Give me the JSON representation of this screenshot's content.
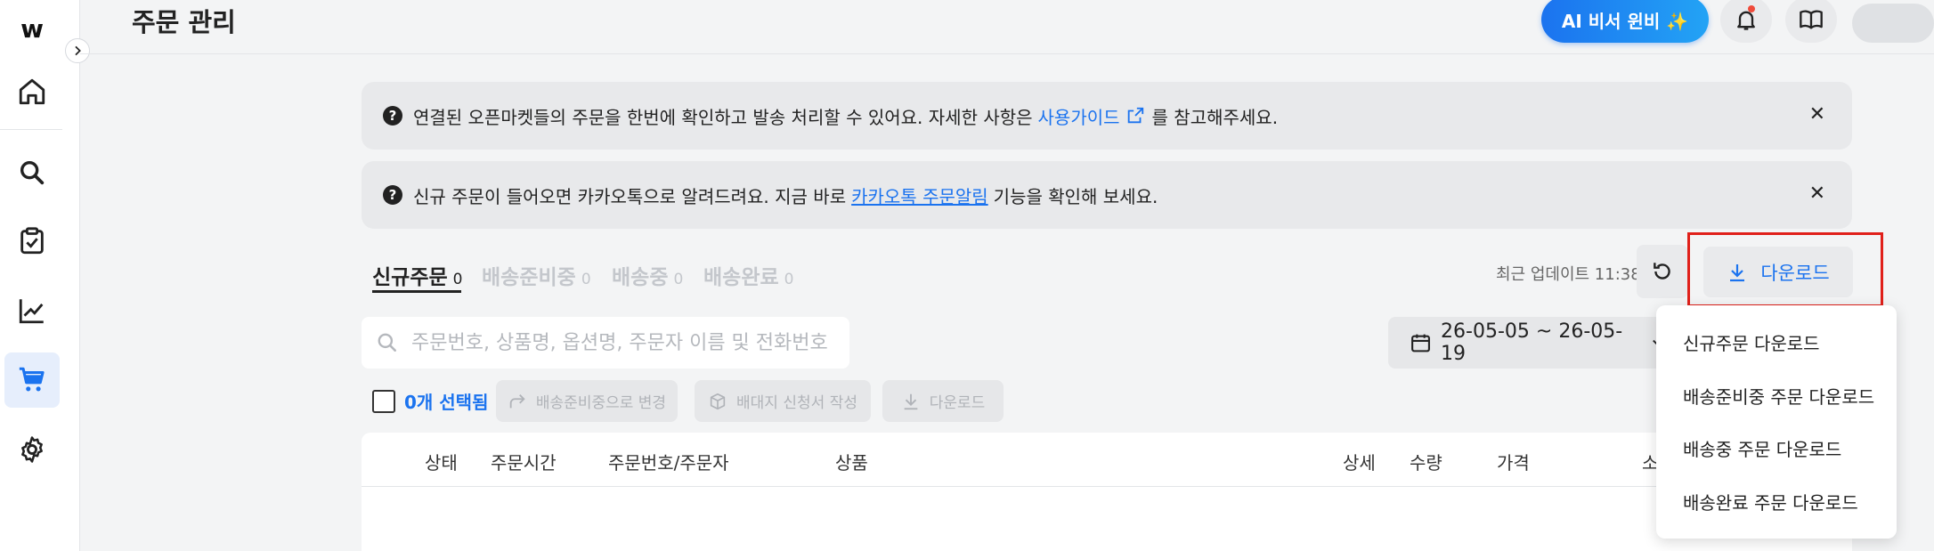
{
  "app": {
    "logo": "w"
  },
  "header": {
    "title": "주문 관리",
    "ai_button": "AI 비서 윈비 ✨"
  },
  "banners": [
    {
      "prefix": "연결된 오픈마켓들의 주문을 한번에 확인하고 발송 처리할 수 있어요. 자세한 사항은",
      "link": "사용가이드",
      "suffix": "를 참고해주세요."
    },
    {
      "prefix": "신규 주문이 들어오면 카카오톡으로 알려드려요. 지금 바로",
      "link": "카카오톡 주문알림",
      "suffix": "기능을 확인해 보세요."
    }
  ],
  "tabs": [
    {
      "label": "신규주문",
      "count": "0",
      "active": true
    },
    {
      "label": "배송준비중",
      "count": "0"
    },
    {
      "label": "배송중",
      "count": "0"
    },
    {
      "label": "배송완료",
      "count": "0"
    }
  ],
  "toolbar": {
    "updated": "최근 업데이트 11:38",
    "download_label": "다운로드"
  },
  "search": {
    "placeholder": "주문번호, 상품명, 옵션명, 주문자 이름 및 전화번호"
  },
  "date_range": {
    "value": "26-05-05 ~ 26-05-19"
  },
  "actions": {
    "selected": "0개 선택됨",
    "to_preparing": "배송준비중으로 변경",
    "shipping_request": "배대지 신청서 작성",
    "download": "다운로드"
  },
  "table": {
    "headers": [
      "상태",
      "주문시간",
      "주문번호/주문자",
      "상품",
      "상세",
      "수량",
      "가격",
      "소"
    ]
  },
  "download_menu": [
    "신규주문 다운로드",
    "배송준비중 주문 다운로드",
    "배송중 주문 다운로드",
    "배송완료 주문 다운로드"
  ],
  "colors": {
    "accent": "#1b73ef",
    "highlight_border": "#e0201a",
    "banner_bg": "#e8e9eb",
    "page_bg": "#f3f4f5"
  }
}
